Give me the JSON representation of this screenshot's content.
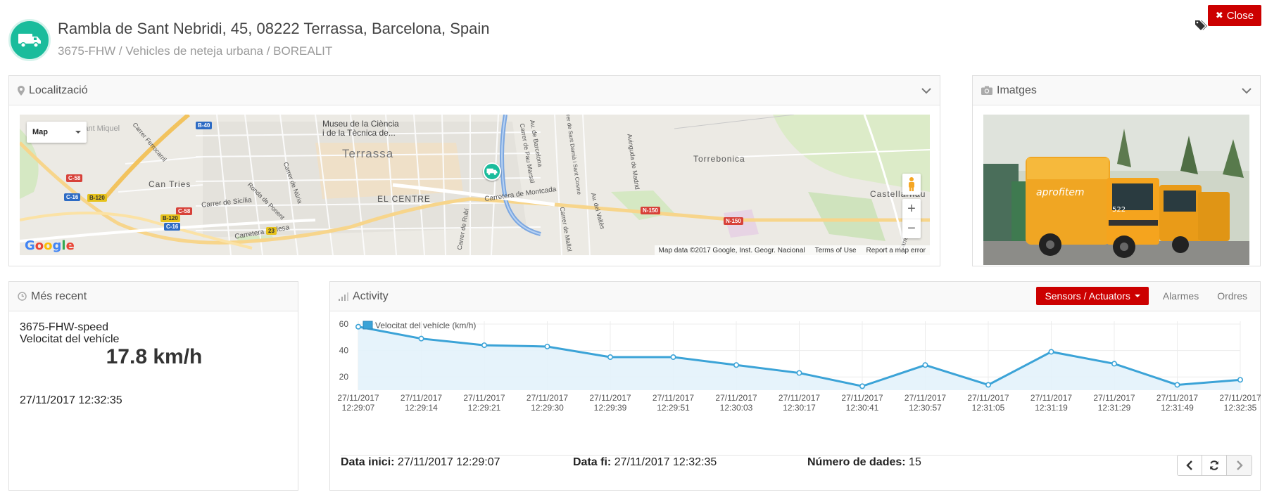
{
  "header": {
    "title": "Rambla de Sant Nebridi, 45, 08222 Terrassa, Barcelona, Spain",
    "subtitle": "3675-FHW / Vehicles de neteja urbana / BOREALIT",
    "close_label": "Close",
    "icon": "truck-icon"
  },
  "location_panel": {
    "title": "Localització",
    "map_type": "Map",
    "footer_data": "Map data ©2017 Google, Inst. Geogr. Nacional",
    "footer_terms": "Terms of Use",
    "footer_report": "Report a map error",
    "google_logo": "Google",
    "labels": {
      "museum": "Museu de la Ciència",
      "museum2": "i de la Tècnica de...",
      "terrassa": "Terrassa",
      "el_centre": "EL CENTRE",
      "torrebonica": "Torrebonica",
      "castellarnau": "Castellarnau",
      "can_tries": "Can Tries",
      "sant_miquel": "Sant Miquel",
      "carretera_montcada": "Carretera de Montcada",
      "carrer_sicilia": "Carrer de Sicília",
      "carretera_olesa": "Carretera d'Olesa",
      "ronda_ponent": "Ronda de Ponent",
      "carrer_nuria": "Carrer de Núria",
      "carrer_ferrocarril": "Carrer Ferrocarril",
      "av_barcelona": "Av. de Barcelona",
      "av_valles": "Av. del Vallès",
      "av_madrid": "Avinguda de Madrid",
      "carrer_rubi": "Carrer de Rubí",
      "carrer_pau_marsal": "Carrer de Pau Marsal",
      "carrer_sant_cosme": "Carrer de Sant Damià i Sant Cosme",
      "carrer_mallol": "Carrer de Mallol",
      "carrer_palau": "Carrer de la Pau"
    },
    "shields": [
      "B-40",
      "C-58",
      "C-16",
      "B-120",
      "C-58",
      "B-120",
      "C-16",
      "N-150",
      "N-150",
      "23"
    ]
  },
  "images_panel": {
    "title": "Imatges",
    "photo_text": "aprofitem",
    "truck_number": "522"
  },
  "recent_panel": {
    "title": "Més recent",
    "sensor": "3675-FHW-speed",
    "label": "Velocitat del vehícle",
    "value": "17.8 km/h",
    "time": "27/11/2017 12:32:35"
  },
  "activity_panel": {
    "title": "Activity",
    "tabs": {
      "active": "Sensors / Actuators",
      "alarms": "Alarmes",
      "orders": "Ordres"
    },
    "start_label": "Data inici:",
    "start_value": "27/11/2017 12:29:07",
    "end_label": "Data fi:",
    "end_value": "27/11/2017 12:32:35",
    "count_label": "Número de dades:",
    "count_value": "15"
  },
  "colors": {
    "accent": "#1abc9c",
    "danger": "#cc0000",
    "line": "#3ba3d7",
    "area": "#e3f2fb"
  },
  "chart_data": {
    "type": "area",
    "series": [
      {
        "name": "Velocitat del vehícle (km/h)",
        "values": [
          58,
          49,
          44,
          43,
          35,
          35,
          29,
          23,
          13,
          29,
          14,
          39,
          30,
          14,
          17.8
        ]
      }
    ],
    "x": [
      [
        "27/11/2017",
        "12:29:07"
      ],
      [
        "27/11/2017",
        "12:29:14"
      ],
      [
        "27/11/2017",
        "12:29:21"
      ],
      [
        "27/11/2017",
        "12:29:30"
      ],
      [
        "27/11/2017",
        "12:29:39"
      ],
      [
        "27/11/2017",
        "12:29:51"
      ],
      [
        "27/11/2017",
        "12:30:03"
      ],
      [
        "27/11/2017",
        "12:30:17"
      ],
      [
        "27/11/2017",
        "12:30:41"
      ],
      [
        "27/11/2017",
        "12:30:57"
      ],
      [
        "27/11/2017",
        "12:31:05"
      ],
      [
        "27/11/2017",
        "12:31:19"
      ],
      [
        "27/11/2017",
        "12:31:29"
      ],
      [
        "27/11/2017",
        "12:31:49"
      ],
      [
        "27/11/2017",
        "12:32:35"
      ]
    ],
    "yticks": [
      20,
      40,
      60
    ],
    "ylim": [
      10,
      60
    ],
    "legend": "top-left",
    "grid": true
  }
}
